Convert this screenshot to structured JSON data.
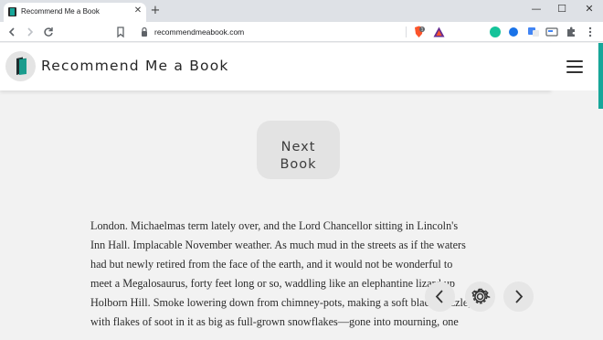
{
  "browser": {
    "tab_title": "Recommend Me a Book",
    "tab_close_glyph": "✕",
    "new_tab_glyph": "+",
    "url": "recommendmeabook.com",
    "window_controls": {
      "minimize": "—",
      "maximize": "☐",
      "close": "✕"
    },
    "icons": {
      "back": "back-arrow-icon",
      "forward": "forward-arrow-icon",
      "reload": "reload-icon",
      "bookmark": "bookmark-icon",
      "lock": "lock-icon",
      "extensions": [
        "brave-shield-icon",
        "brave-rewards-icon",
        "grammarly-icon",
        "extension-blue-icon",
        "translate-icon",
        "screenshot-icon",
        "puzzle-icon",
        "kebab-menu-icon"
      ]
    },
    "brave_badge": "1",
    "colors": {
      "tabstrip": "#dee1e6",
      "brave": "#fb542b",
      "grammarly": "#15c39a"
    }
  },
  "header": {
    "title": "Recommend Me a Book",
    "logo_icon": "book-logo-icon",
    "menu_icon": "hamburger-menu-icon",
    "accent_color": "#17a79a"
  },
  "main": {
    "next_button": {
      "line1": "Next",
      "line2": "Book"
    },
    "excerpt_lines": [
      "London. Michaelmas term lately over, and the Lord Chancellor sitting in Lincoln's",
      "Inn Hall. Implacable November weather. As much mud in the streets as if the waters",
      "had but newly retired from the face of the earth, and it would not be wonderful to",
      "meet a Megalosaurus, forty feet long or so, waddling like an elephantine lizard up",
      "Holborn Hill. Smoke lowering down from chimney-pots, making a soft black drizzle,",
      "with flakes of soot in it as big as full-grown snowflakes—gone into mourning, one"
    ],
    "controls": {
      "prev": "chevron-left-icon",
      "settings": "gear-icon",
      "next": "chevron-right-icon"
    }
  }
}
